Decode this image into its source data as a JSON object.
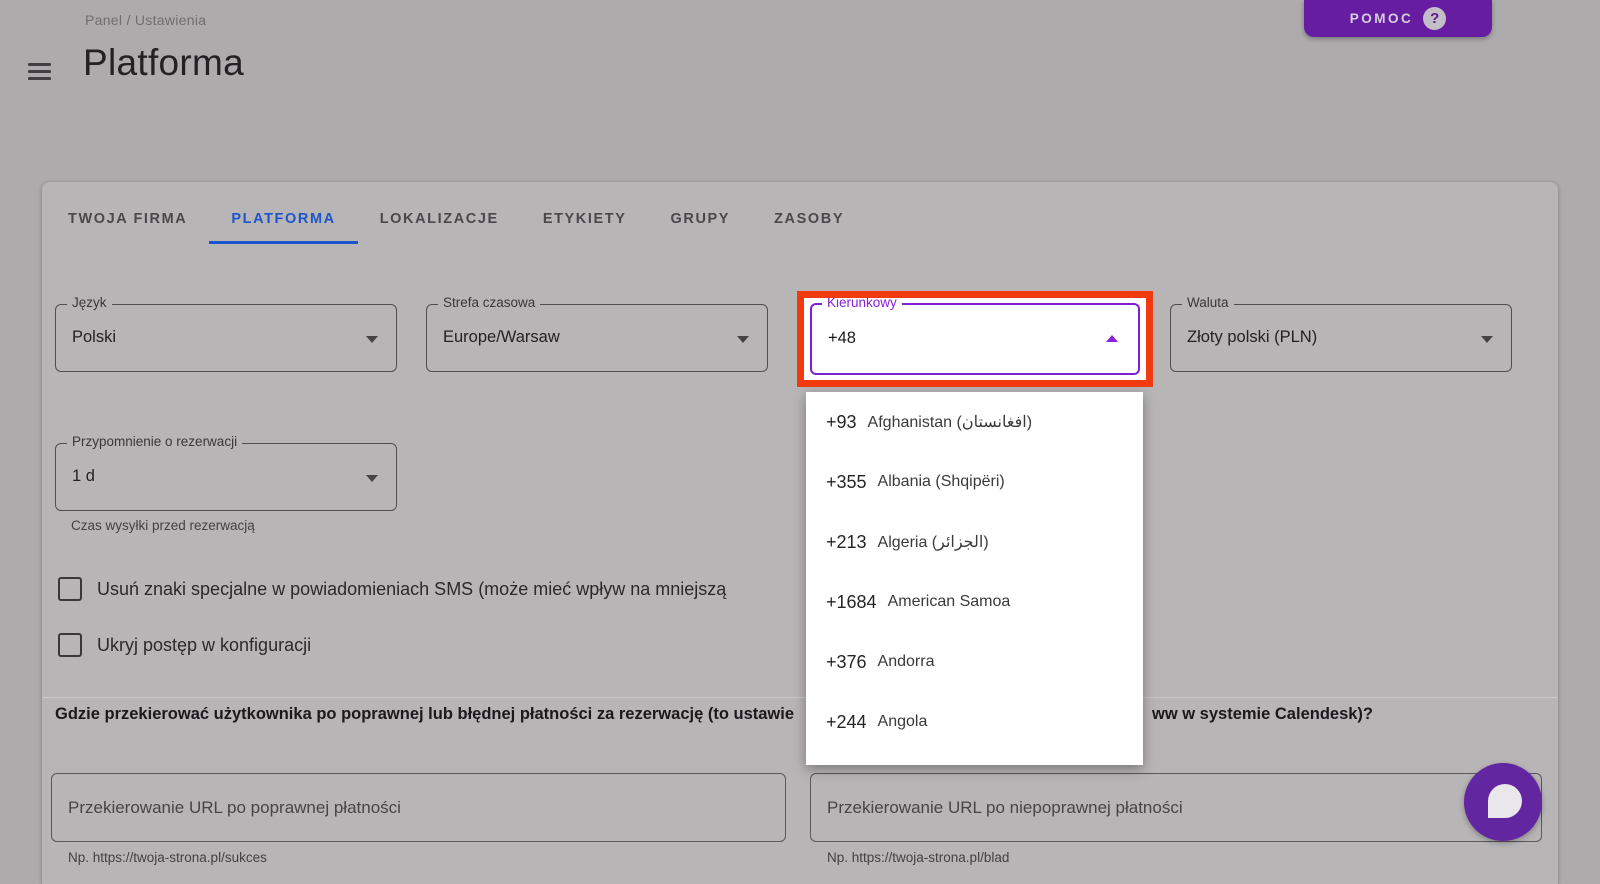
{
  "header": {
    "breadcrumb": "Panel / Ustawienia",
    "title": "Platforma",
    "help_button_label": "POMOC",
    "help_icon_glyph": "?"
  },
  "tabs": {
    "active": "PLATFORMA",
    "items": [
      {
        "label": "TWOJA FIRMA"
      },
      {
        "label": "PLATFORMA"
      },
      {
        "label": "LOKALIZACJE"
      },
      {
        "label": "ETYKIETY"
      },
      {
        "label": "GRUPY"
      },
      {
        "label": "ZASOBY"
      }
    ]
  },
  "form": {
    "language": {
      "label": "Język",
      "value": "Polski"
    },
    "timezone": {
      "label": "Strefa czasowa",
      "value": "Europe/Warsaw"
    },
    "dial_code": {
      "label": "Kierunkowy",
      "value": "+48"
    },
    "currency": {
      "label": "Waluta",
      "value": "Złoty polski (PLN)"
    },
    "reminder": {
      "label": "Przypomnienie o rezerwacji",
      "value": "1 d",
      "helper": "Czas wysyłki przed rezerwacją"
    }
  },
  "dial_code_dropdown": {
    "items": [
      {
        "code": "+93",
        "name": "Afghanistan (افغانستان)"
      },
      {
        "code": "+355",
        "name": "Albania (Shqipëri)"
      },
      {
        "code": "+213",
        "name": "Algeria (الجزائر)"
      },
      {
        "code": "+1684",
        "name": "American Samoa"
      },
      {
        "code": "+376",
        "name": "Andorra"
      },
      {
        "code": "+244",
        "name": "Angola"
      }
    ]
  },
  "checkboxes": [
    {
      "label": "Usuń znaki specjalne w powiadomieniach SMS (może mieć wpływ na mniejszą",
      "checked": false
    },
    {
      "label": "Ukryj postęp w konfiguracji",
      "checked": false
    }
  ],
  "payment_question": {
    "left": "Gdzie przekierować użytkownika po poprawnej lub błędnej płatności za rezerwację (to ustawie",
    "right": "ww w systemie Calendesk)?"
  },
  "url_fields": {
    "success": {
      "placeholder": "Przekierowanie URL po poprawnej płatności",
      "helper": "Np. https://twoja-strona.pl/sukces"
    },
    "error": {
      "placeholder": "Przekierowanie URL po niepoprawnej płatności",
      "helper": "Np. https://twoja-strona.pl/blad"
    }
  },
  "colors": {
    "accent_purple": "#8b21d8",
    "annotation_red": "#f23a10",
    "active_tab_blue": "#1d55cc",
    "brand_purple": "#671da1"
  }
}
